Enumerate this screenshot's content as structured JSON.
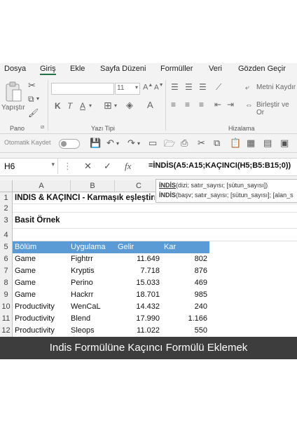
{
  "menu": {
    "tabs": [
      "Dosya",
      "Giriş",
      "Ekle",
      "Sayfa Düzeni",
      "Formüller",
      "Veri",
      "Gözden Geçir"
    ],
    "active": "Giriş"
  },
  "ribbon": {
    "paste_label": "Yapıştır",
    "font_size": "11",
    "bold": "K",
    "italic": "T",
    "underline": "A",
    "wrap_text": "Metni Kaydır",
    "merge_center": "Birleştir ve Or",
    "group_pano": "Pano",
    "group_font": "Yazı Tipi",
    "group_align": "Hizalama"
  },
  "qat": {
    "autosave_label": "Otomatik Kaydet"
  },
  "formula_bar": {
    "name_box": "H6",
    "cancel_icon": "✕",
    "enter_icon": "✓",
    "fx_label": "fx",
    "formula": "=İNDİS(A5:A15;KAÇINCI(H5;B5:B15;0))"
  },
  "tooltip": {
    "line1_fn": "İNDİS",
    "line1_args": "(dizi; satır_sayısı; [sütun_sayısı])",
    "line2_fn": "İNDİS",
    "line2_args": "(başv; satır_sayısı; [sütun_sayısı]; [alan_s"
  },
  "sheet": {
    "columns": [
      "A",
      "B",
      "C",
      "D"
    ],
    "rows": [
      "1",
      "2",
      "3",
      "4",
      "5",
      "6",
      "7",
      "8",
      "9",
      "10",
      "11",
      "12"
    ],
    "title": "INDIS & KAÇINCI - Karmaşık eşleştirmeler için mükemmel bir ayar",
    "subtitle": "Basit Örnek",
    "table_headers": [
      "Bölüm",
      "Uygulama",
      "Gelir",
      "Kar"
    ],
    "table_rows": [
      [
        "Game",
        "Fightrr",
        "11.649",
        "802"
      ],
      [
        "Game",
        "Kryptis",
        "7.718",
        "876"
      ],
      [
        "Game",
        "Perino",
        "15.033",
        "469"
      ],
      [
        "Game",
        "Hackrr",
        "18.701",
        "985"
      ],
      [
        "Productivity",
        "WenCaL",
        "14.432",
        "240"
      ],
      [
        "Productivity",
        "Blend",
        "17.990",
        "1.166"
      ],
      [
        "Productivity",
        "Sleops",
        "11.022",
        "550"
      ]
    ]
  },
  "caption": "Indis Formülüne Kaçıncı Formülü Eklemek",
  "colors": {
    "accent": "#217346",
    "table_header": "#5b9bd5",
    "caption_bg": "#3d3d3d"
  }
}
